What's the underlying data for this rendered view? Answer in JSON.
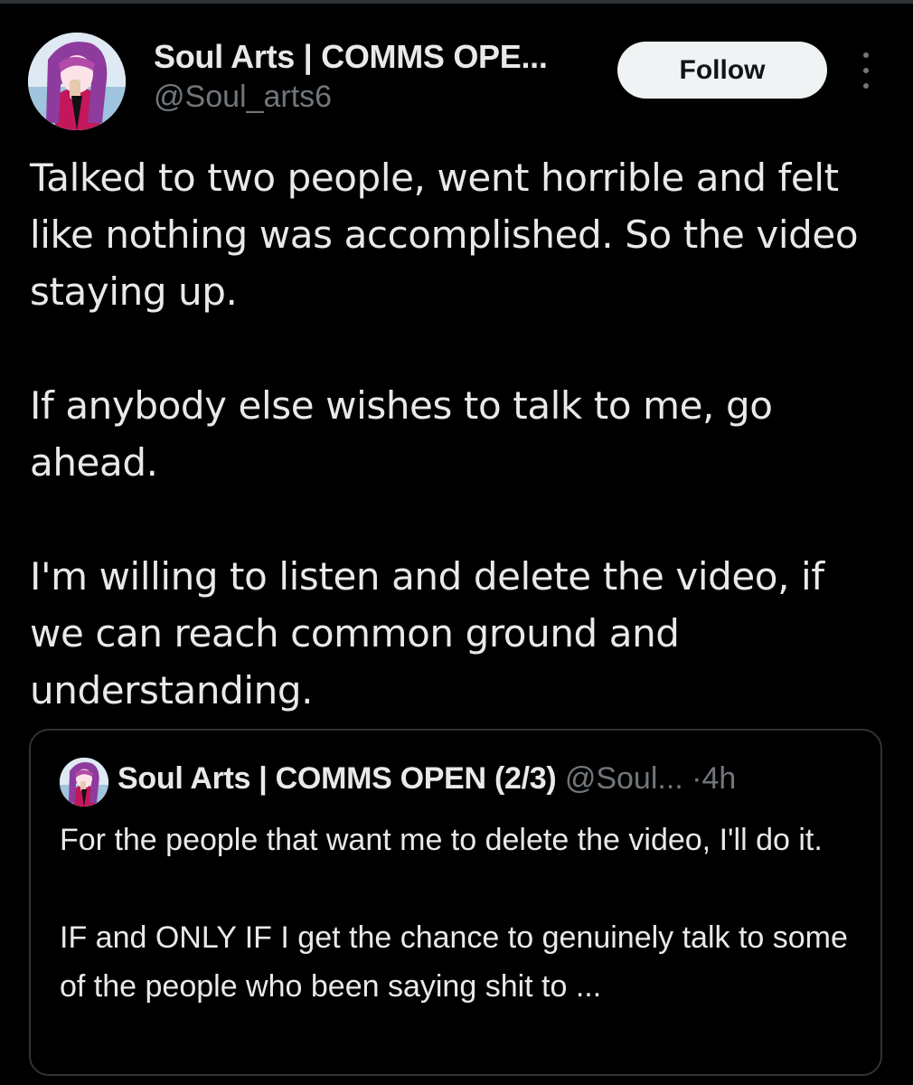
{
  "author": {
    "display_name": "Soul Arts | COMMS OPE...",
    "handle": "@Soul_arts6",
    "avatar_icon": "anime-girl-avatar-icon"
  },
  "follow_label": "Follow",
  "more_icon": "more-options-icon",
  "tweet": {
    "paragraphs": [
      "Talked to two people, went horrible and felt like nothing was accomplished. So the video staying up.",
      "If anybody else wishes to talk to me, go ahead.",
      "I'm willing to listen and delete the video, if we can reach common ground and understanding."
    ]
  },
  "quoted_tweet": {
    "display_name": "Soul Arts | COMMS OPEN (2/3)",
    "handle": "@Soul...",
    "separator": "·",
    "time": "4h",
    "paragraphs": [
      "For the people that want me to delete the video, I'll do it.",
      "IF and ONLY IF I get the chance to genuinely talk to some of the people who been saying shit to ..."
    ]
  },
  "colors": {
    "background": "#000000",
    "text_primary": "#e7e9ea",
    "text_secondary": "#71767b",
    "border": "#2f3336",
    "follow_button_bg": "#eff3f4"
  }
}
